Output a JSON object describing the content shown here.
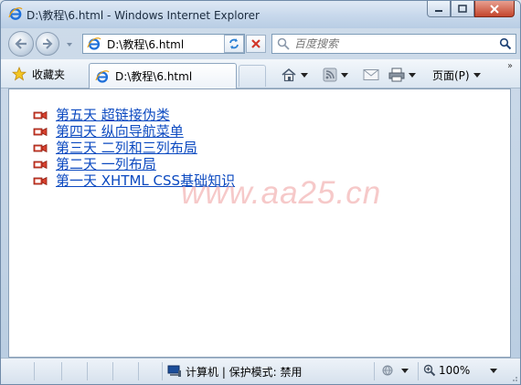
{
  "window": {
    "title": "D:\\教程\\6.html - Windows Internet Explorer",
    "minimize_icon": "minimize-icon",
    "maximize_icon": "maximize-icon",
    "close_icon": "close-icon"
  },
  "navigation": {
    "address": "D:\\教程\\6.html",
    "search_placeholder": "百度搜索"
  },
  "commandbar": {
    "favorites_label": "收藏夹",
    "tab_label": "D:\\教程\\6.html",
    "page_label": "页面(P)"
  },
  "content": {
    "links": [
      {
        "label": "第五天 超链接伪类"
      },
      {
        "label": "第四天 纵向导航菜单"
      },
      {
        "label": "第三天 二列和三列布局"
      },
      {
        "label": "第二天 一列布局"
      },
      {
        "label": "第一天  XHTML CSS基础知识"
      }
    ],
    "watermark": "www.aa25.cn"
  },
  "statusbar": {
    "zone_text": "计算机 | 保护模式: 禁用",
    "zoom": "100%"
  },
  "colors": {
    "link": "#0b49c0",
    "bullet": "#c0281c",
    "watermark": "#f6c9c9"
  }
}
